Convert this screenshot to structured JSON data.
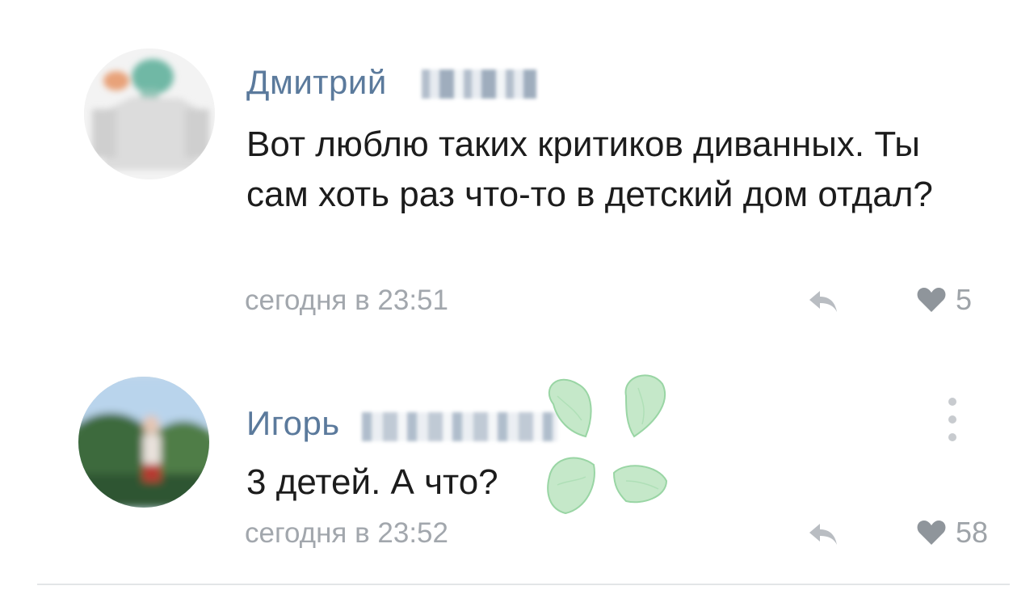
{
  "comments": [
    {
      "author": "Дмитрий",
      "text": "Вот люблю таких критиков диванных. Ты сам хоть раз что-то в детский дом отдал?",
      "time": "сегодня в 23:51",
      "likes": "5"
    },
    {
      "author": "Игорь",
      "text": "3 детей. А что?",
      "time": "сегодня в 23:52",
      "likes": "58"
    }
  ],
  "colors": {
    "author": "#5b7a9c",
    "text": "#1c1c1c",
    "meta": "#a2a7ad",
    "icon": "#9ea3a8",
    "clover": "#a9dcb0"
  },
  "icons": [
    "reply-icon",
    "heart-icon",
    "more-vertical-icon",
    "clover-sticker-icon"
  ]
}
